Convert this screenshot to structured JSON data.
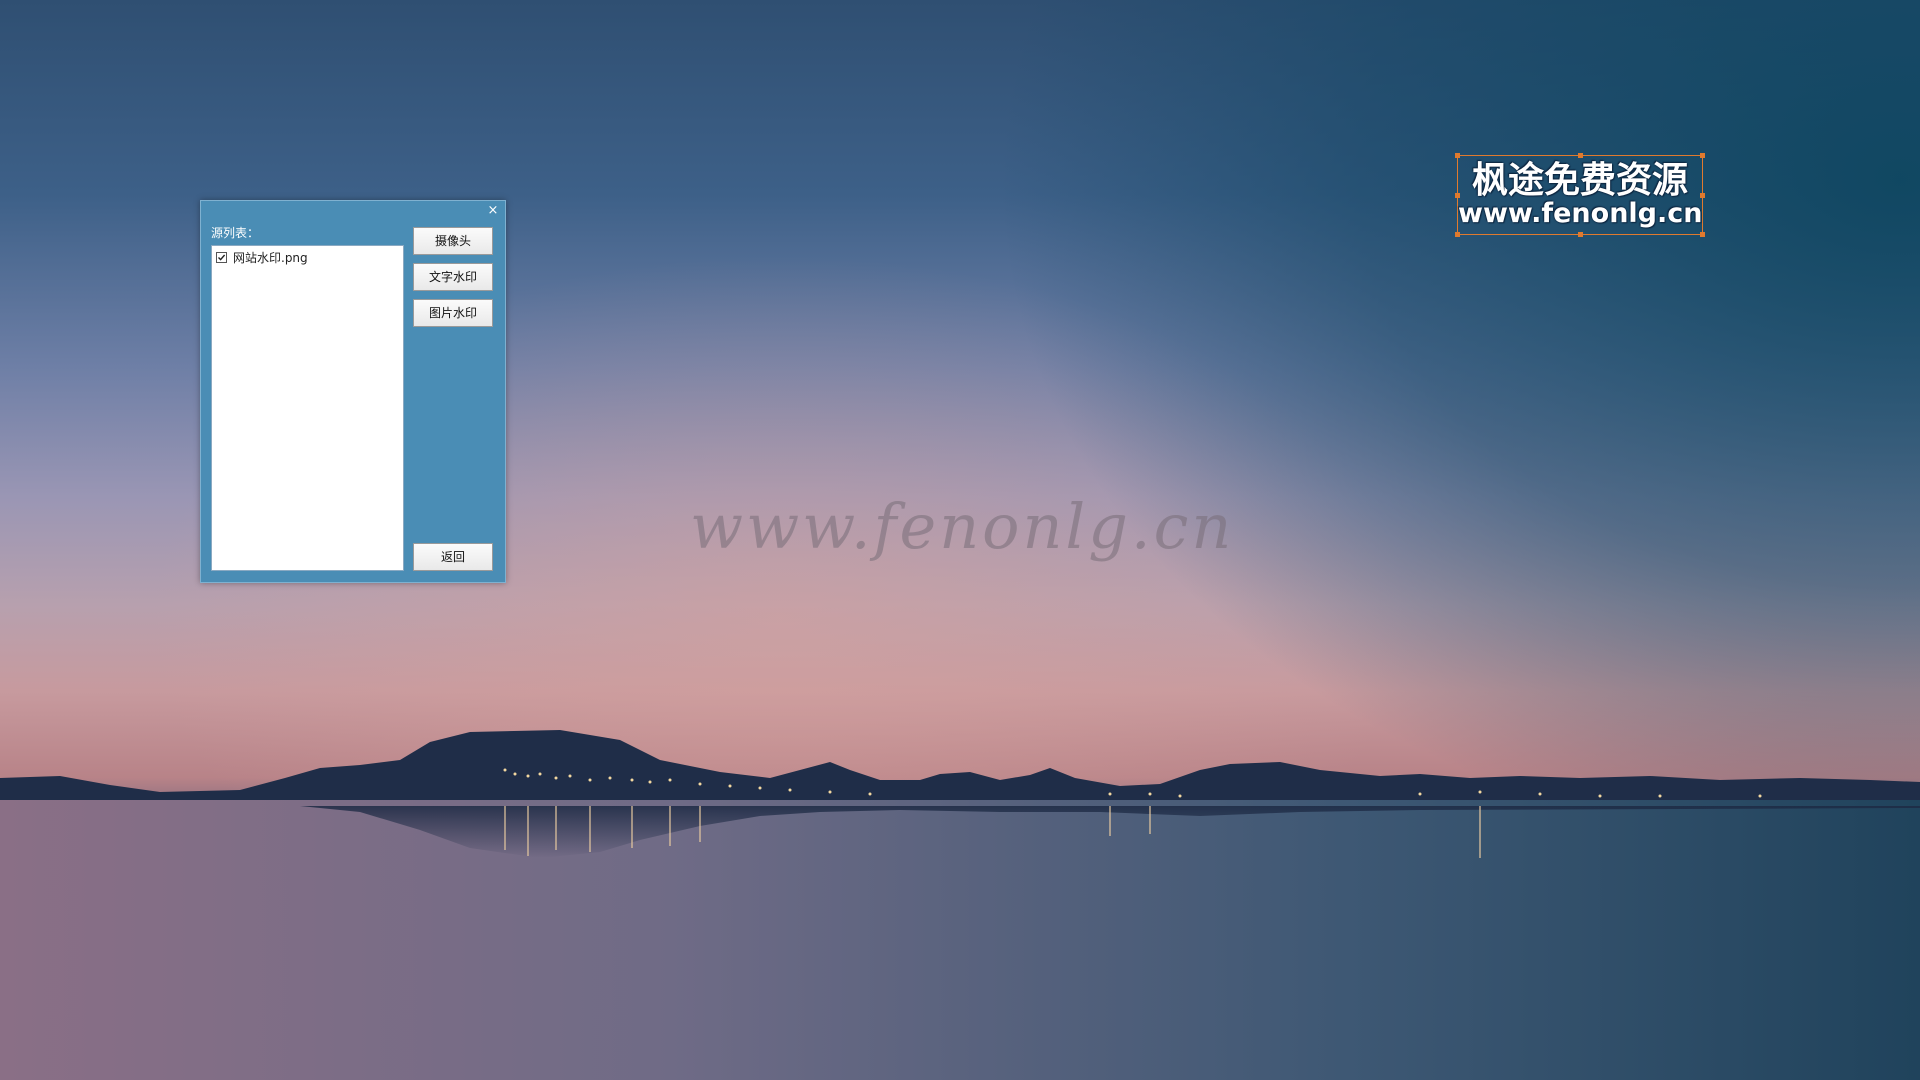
{
  "dialog": {
    "close_glyph": "×",
    "list_label": "源列表：",
    "source_items": [
      {
        "label": "网站水印.png",
        "checked": true
      }
    ],
    "buttons": {
      "camera": "摄像头",
      "text_watermark": "文字水印",
      "image_watermark": "图片水印",
      "back": "返回"
    }
  },
  "background": {
    "cursive_watermark": "www.fenonlg.cn"
  },
  "logo_watermark": {
    "title": "枫途免费资源",
    "url": "www.fenonlg.cn"
  },
  "colors": {
    "dialog_bg": "#4a8db5",
    "selection_handles": "#e07a2e"
  }
}
